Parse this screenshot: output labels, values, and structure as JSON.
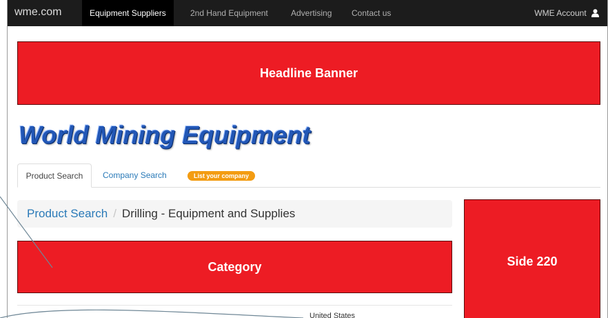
{
  "navbar": {
    "brand": "wme.com",
    "items": [
      {
        "label": "Equipment Suppliers",
        "active": true
      },
      {
        "label": "2nd Hand Equipment",
        "active": false
      },
      {
        "label": "Advertising",
        "active": false
      },
      {
        "label": "Contact us",
        "active": false
      }
    ],
    "account_label": "WME Account",
    "account_icon": "user-icon"
  },
  "headline_banner": "Headline Banner",
  "logo_text": "World Mining Equipment",
  "tabs": {
    "product_search": "Product Search",
    "company_search": "Company Search",
    "list_badge": "List your company"
  },
  "breadcrumb": {
    "root": "Product Search",
    "separator": "/",
    "current": "Drilling - Equipment and Supplies"
  },
  "category_banner": "Category",
  "side_banner": "Side 220",
  "partial_text": "United States",
  "colors": {
    "banner_red": "#ed1c24",
    "link_blue": "#2a7ab8",
    "logo_blue": "#2257b6",
    "badge_orange": "#f39c12",
    "navbar": "#1c1c1c"
  }
}
